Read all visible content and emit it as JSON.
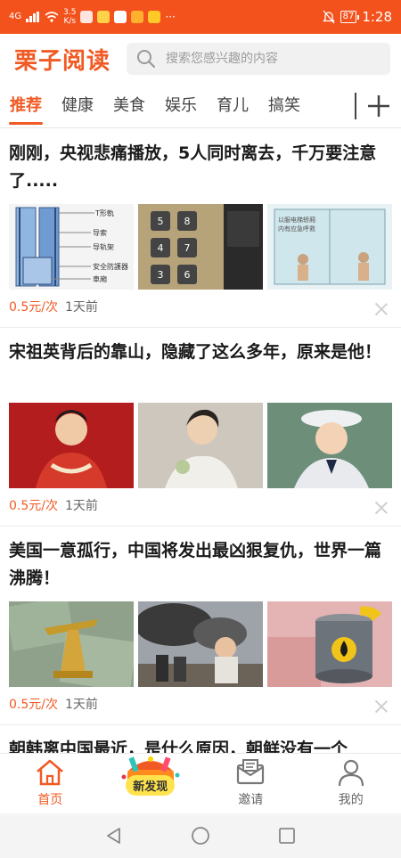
{
  "status_bar": {
    "signal_text": "4G",
    "net_speed": "3.5",
    "net_unit": "K/s",
    "battery": "87",
    "time": "1:28"
  },
  "header": {
    "logo": "栗子阅读",
    "search_placeholder": "搜索您感兴趣的内容"
  },
  "tabs": [
    "推荐",
    "健康",
    "美食",
    "娱乐",
    "育儿",
    "搞笑"
  ],
  "articles": [
    {
      "title": "刚刚，央视悲痛播放，5人同时离去，千万要注意了.....",
      "price": "0.5元/次",
      "time": "1天前",
      "thumb_labels": [
        "T形軌",
        "导索",
        "导轨架",
        "安全防護器",
        "車廂"
      ],
      "thumb2_labels": [
        "5",
        "8",
        "4",
        "7",
        "3",
        "6"
      ],
      "thumb3_labels": [
        "以服电梯轿厢",
        "内有应急呼救"
      ]
    },
    {
      "title": "宋祖英背后的靠山，隐藏了这么多年，原来是他！",
      "price": "0.5元/次",
      "time": "1天前"
    },
    {
      "title": "美国一意孤行，中国将发出最凶狠复仇，世界一篇沸腾！",
      "price": "0.5元/次",
      "time": "1天前"
    }
  ],
  "partial_article": {
    "title": "朝韩离中国最近，是什么原因，朝鲜没有一个"
  },
  "bottom_nav": {
    "home": "首页",
    "discover": "新发现",
    "invite": "邀请",
    "mine": "我的"
  },
  "colors": {
    "accent": "#f15a24",
    "status_bar": "#f3521d"
  }
}
